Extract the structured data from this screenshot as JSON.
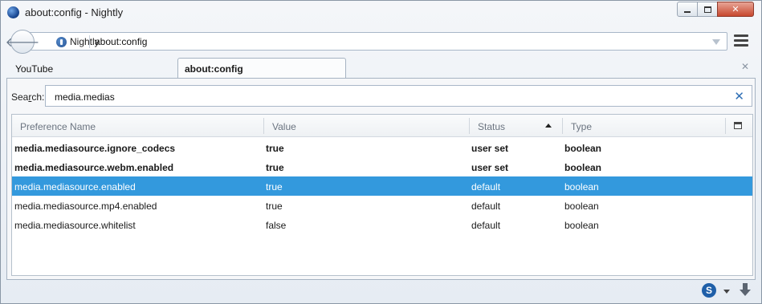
{
  "window": {
    "title": "about:config - Nightly"
  },
  "nav": {
    "identity_label": "Nightly",
    "url": "about:config"
  },
  "tabs": [
    {
      "label": "YouTube",
      "active": false
    },
    {
      "label": "about:config",
      "active": true
    }
  ],
  "search": {
    "label_prefix": "Sea",
    "label_accel": "r",
    "label_suffix": "ch:",
    "value": "media.medias"
  },
  "table": {
    "columns": [
      "Preference Name",
      "Value",
      "Status",
      "Type"
    ],
    "sort_column": "Status",
    "rows": [
      {
        "name": "media.mediasource.ignore_codecs",
        "value": "true",
        "status": "user set",
        "type": "boolean",
        "bold": true,
        "selected": false
      },
      {
        "name": "media.mediasource.webm.enabled",
        "value": "true",
        "status": "user set",
        "type": "boolean",
        "bold": true,
        "selected": false
      },
      {
        "name": "media.mediasource.enabled",
        "value": "true",
        "status": "default",
        "type": "boolean",
        "bold": false,
        "selected": true
      },
      {
        "name": "media.mediasource.mp4.enabled",
        "value": "true",
        "status": "default",
        "type": "boolean",
        "bold": false,
        "selected": false
      },
      {
        "name": "media.mediasource.whitelist",
        "value": "false",
        "status": "default",
        "type": "boolean",
        "bold": false,
        "selected": false
      }
    ]
  },
  "statusbar": {
    "addon_letter": "S"
  },
  "colors": {
    "selection": "#3399dd",
    "close_button": "#c7482f"
  }
}
